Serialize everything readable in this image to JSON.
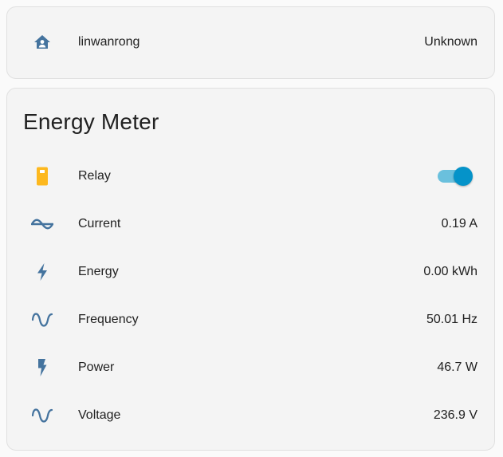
{
  "person": {
    "name": "linwanrong",
    "state": "Unknown",
    "icon": "home-account-icon"
  },
  "energy_meter": {
    "title": "Energy Meter",
    "rows": [
      {
        "label": "Relay",
        "icon": "relay-switch-icon",
        "toggle_on": true
      },
      {
        "label": "Current",
        "value": "0.19 A",
        "icon": "current-ac-icon"
      },
      {
        "label": "Energy",
        "value": "0.00 kWh",
        "icon": "lightning-bolt-icon"
      },
      {
        "label": "Frequency",
        "value": "50.01 Hz",
        "icon": "sine-wave-icon"
      },
      {
        "label": "Power",
        "value": "46.7 W",
        "icon": "flash-icon"
      },
      {
        "label": "Voltage",
        "value": "236.9 V",
        "icon": "sine-wave-icon"
      }
    ]
  },
  "colors": {
    "icon": "#44739e",
    "relay_icon": "#fdb81e",
    "toggle_knob": "#0593c9",
    "toggle_track": "#6ac0dd"
  }
}
